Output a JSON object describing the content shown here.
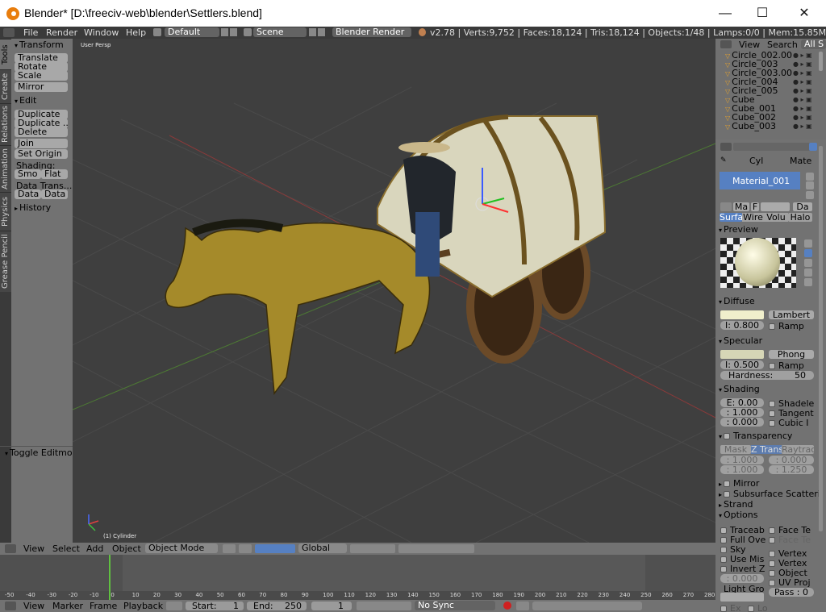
{
  "window": {
    "title": "Blender* [D:\\freeciv-web\\blender\\Settlers.blend]",
    "minimize": "—",
    "maximize": "☐",
    "close": "✕"
  },
  "menubar": {
    "items": [
      "File",
      "Render",
      "Window",
      "Help"
    ],
    "layout_value": "Default",
    "scene_value": "Scene",
    "engine_value": "Blender Render",
    "stats": "v2.78 | Verts:9,752 | Faces:18,124 | Tris:18,124 | Objects:1/48 | Lamps:0/0 | Mem:15.85M | Cyli"
  },
  "side_tabs": [
    "Tools",
    "Create",
    "Relations",
    "Animation",
    "Physics",
    "Grease Pencil"
  ],
  "tool_shelf": {
    "transform": "Transform",
    "translate": "Translate",
    "rotate": "Rotate",
    "scale": "Scale",
    "mirror": "Mirror",
    "edit": "Edit",
    "duplicate": "Duplicate",
    "duplicate_linked": "Duplicate ...",
    "delete": "Delete",
    "join": "Join",
    "set_origin": "Set Origin",
    "shading": "Shading:",
    "smooth": "Smo",
    "flat": "Flat",
    "data_transfer": "Data Trans...",
    "data1": "Data",
    "data2": "Data",
    "history": "History",
    "toggle_editmode": "Toggle Editmo"
  },
  "viewport": {
    "view_label": "User Persp",
    "object_label": "(1) Cylinder"
  },
  "viewport_header": {
    "menus": [
      "View",
      "Select",
      "Add",
      "Object"
    ],
    "mode": "Object Mode",
    "orientation": "Global"
  },
  "timeline": {
    "ticks": [
      "-50",
      "-40",
      "-30",
      "-20",
      "-10",
      "0",
      "10",
      "20",
      "30",
      "40",
      "50",
      "60",
      "70",
      "80",
      "90",
      "100",
      "110",
      "120",
      "130",
      "140",
      "150",
      "160",
      "170",
      "180",
      "190",
      "200",
      "210",
      "220",
      "230",
      "240",
      "250",
      "260",
      "270",
      "280"
    ],
    "current_frame_fraction": 0.152,
    "menus": [
      "View",
      "Marker",
      "Frame",
      "Playback"
    ],
    "start_label": "Start:",
    "start_value": "1",
    "end_label": "End:",
    "end_value": "250",
    "current": "1",
    "sync": "No Sync"
  },
  "outliner": {
    "menus": [
      "View",
      "Search"
    ],
    "filter": "All S",
    "items": [
      "Circle_002.00",
      "Circle_003",
      "Circle_003.00",
      "Circle_004",
      "Circle_005",
      "Cube",
      "Cube_001",
      "Cube_002",
      "Cube_003"
    ]
  },
  "properties": {
    "breadcrumb_object": "Cyl",
    "breadcrumb_material": "Mate",
    "material_slot": "Material_001",
    "mat_name": "Ma",
    "mat_f": "F",
    "data_btn": "Da",
    "type_tabs": [
      "Surfa",
      "Wire",
      "Volu",
      "Halo"
    ],
    "preview": "Preview",
    "diffuse": "Diffuse",
    "diffuse_shader": "Lambert",
    "diffuse_intensity": "I: 0.800",
    "ramp": "Ramp",
    "specular": "Specular",
    "specular_shader": "Phong",
    "specular_intensity": "I: 0.500",
    "hardness_label": "Hardness:",
    "hardness_value": "50",
    "shading": "Shading",
    "emit": "E: 0.00",
    "ambient": ": 1.000",
    "translucency": ": 0.000",
    "shadeless": "Shadele",
    "tangent": "Tangent",
    "cubic": "Cubic I",
    "transparency": "Transparency",
    "trans_tabs": [
      "Mask",
      "Z Trans",
      "Raytrac"
    ],
    "alpha": ": 1.000",
    "fresnel": ": 0.000",
    "specular_alpha": ": 1.000",
    "blend": ": 1.250",
    "mirror": "Mirror",
    "sss": "Subsurface Scatteri",
    "strand": "Strand",
    "options": "Options",
    "traceable": "Traceab",
    "full_oversampling": "Full Ove",
    "sky": "Sky",
    "use_mist": "Use Mis",
    "invert_z": "Invert Z",
    "zoffset": ": 0.000",
    "light_group": "Light Gro",
    "face_textures": "Face Te",
    "face_textures_alpha": "Face Te",
    "vertex_color_paint": "Vertex",
    "vertex_color_light": "Vertex",
    "object_color": "Object",
    "uv_project": "UV Proj",
    "pass": "Pass : 0",
    "exclusive": "Ex",
    "light": "Lo"
  },
  "colors": {
    "diffuse": "#f0efcc",
    "specular": "#d6d6b6",
    "selected": "#5680c2"
  }
}
